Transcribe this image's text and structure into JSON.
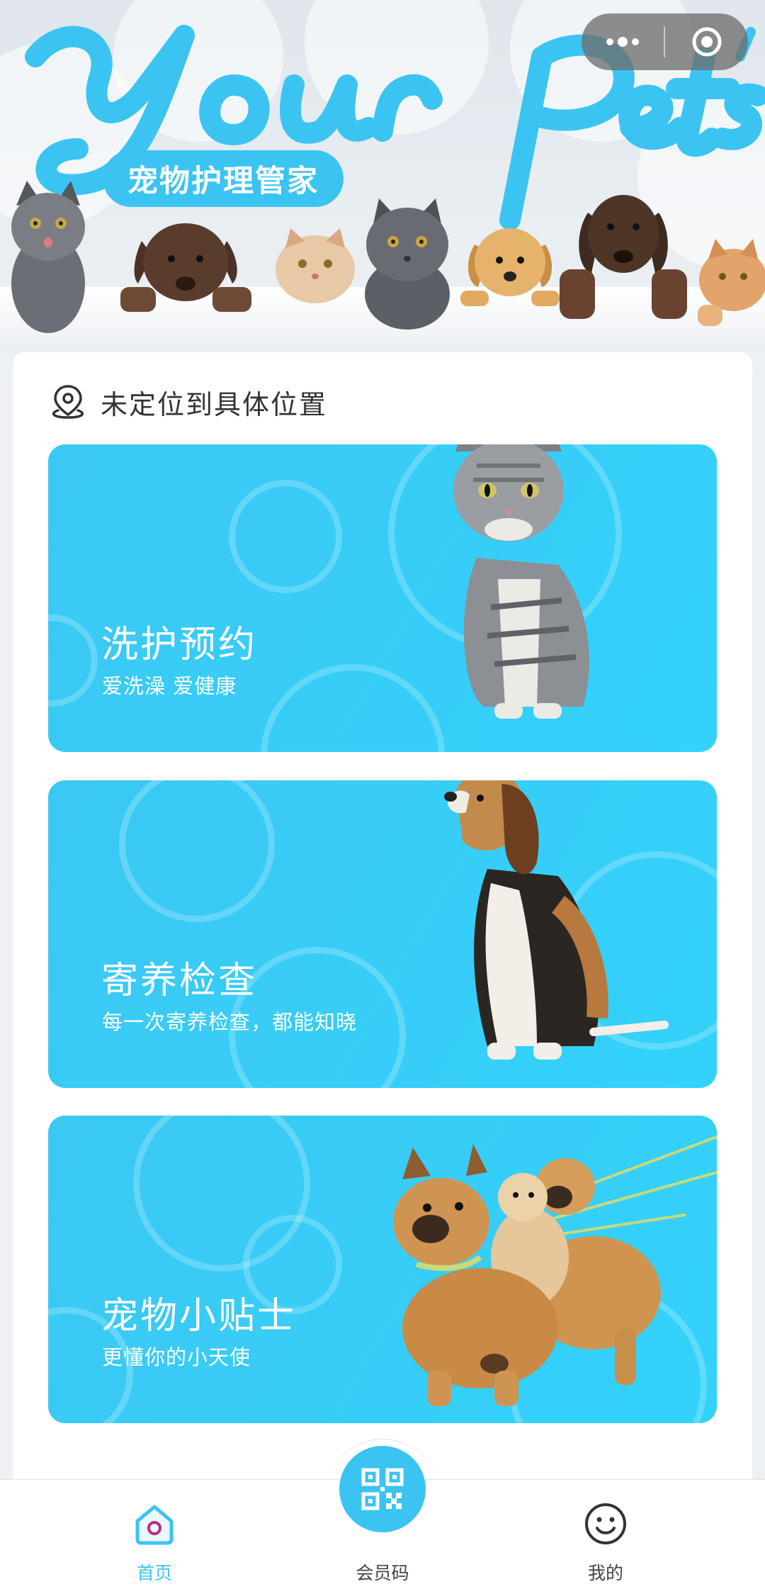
{
  "header": {
    "brand_script": "Your Pet's",
    "slogan": "宠物护理管家",
    "menu_icon": "more-dots-icon",
    "close_icon": "target-close-icon"
  },
  "location": {
    "icon": "location-pin-icon",
    "text": "未定位到具体位置"
  },
  "services": [
    {
      "title": "洗护预约",
      "subtitle": "爱洗澡 爱健康",
      "image": "cat-photo"
    },
    {
      "title": "寄养检查",
      "subtitle": "每一次寄养检查，都能知晓",
      "image": "beagle-photo"
    },
    {
      "title": "宠物小贴士",
      "subtitle": "更懂你的小天使",
      "image": "dogs-on-leash-photo"
    }
  ],
  "tabbar": {
    "home": {
      "label": "首页",
      "icon": "home-icon"
    },
    "member": {
      "label": "会员码",
      "icon": "qr-code-icon"
    },
    "mine": {
      "label": "我的",
      "icon": "smiley-face-icon"
    }
  },
  "colors": {
    "accent": "#3bc4f2",
    "card_blue": "#33d2fb",
    "page_bg": "#eef1f4",
    "text_dark": "#333333"
  }
}
